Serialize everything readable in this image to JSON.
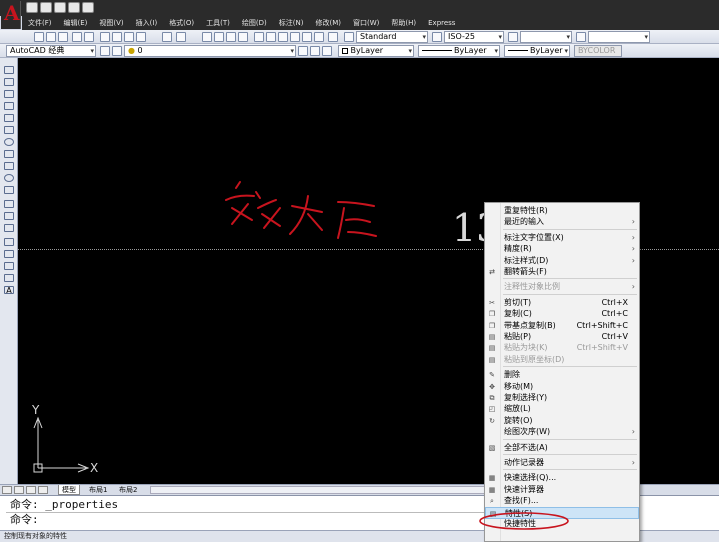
{
  "menu": [
    "文件(F)",
    "编辑(E)",
    "视图(V)",
    "插入(I)",
    "格式(O)",
    "工具(T)",
    "绘图(D)",
    "标注(N)",
    "修改(M)",
    "窗口(W)",
    "帮助(H)",
    "Express"
  ],
  "toolbar": {
    "text_style": "Standard",
    "dim_style": "ISO-25",
    "workspace": "AutoCAD 经典",
    "layer": "0",
    "color": "ByLayer",
    "linetype": "ByLayer",
    "lineweight": "ByLayer",
    "plotstyle": "BYCOLOR"
  },
  "canvas": {
    "dimension_text": "13",
    "ucs_x": "X",
    "ucs_y": "Y",
    "background": "#000000",
    "annotation_color": "#c8141e"
  },
  "tabs": [
    "模型",
    "布局1",
    "布局2"
  ],
  "command": {
    "line1": "命令: _properties",
    "line2": "命令:"
  },
  "status": "控制现有对象的特性",
  "context_menu": [
    {
      "label": "重复特性(R)",
      "icon": ""
    },
    {
      "label": "最近的输入",
      "arrow": true
    },
    {
      "sep": true
    },
    {
      "label": "标注文字位置(X)",
      "arrow": true
    },
    {
      "label": "精度(R)",
      "arrow": true
    },
    {
      "label": "标注样式(D)",
      "arrow": true
    },
    {
      "label": "翻转箭头(F)",
      "icon": "flip-arrow-icon"
    },
    {
      "sep": true
    },
    {
      "label": "注释性对象比例",
      "arrow": true,
      "disabled": true
    },
    {
      "sep": true
    },
    {
      "label": "剪切(T)",
      "shortcut": "Ctrl+X",
      "icon": "scissors-icon"
    },
    {
      "label": "复制(C)",
      "shortcut": "Ctrl+C",
      "icon": "copy-icon"
    },
    {
      "label": "带基点复制(B)",
      "shortcut": "Ctrl+Shift+C",
      "icon": "copy-base-icon"
    },
    {
      "label": "粘贴(P)",
      "shortcut": "Ctrl+V",
      "icon": "paste-icon"
    },
    {
      "label": "粘贴为块(K)",
      "shortcut": "Ctrl+Shift+V",
      "icon": "paste-block-icon",
      "disabled": true
    },
    {
      "label": "粘贴到原坐标(D)",
      "icon": "paste-orig-icon",
      "disabled": true
    },
    {
      "sep": true
    },
    {
      "label": "删除",
      "icon": "erase-icon"
    },
    {
      "label": "移动(M)",
      "icon": "move-icon"
    },
    {
      "label": "复制选择(Y)",
      "icon": "copy-select-icon"
    },
    {
      "label": "缩放(L)",
      "icon": "scale-icon"
    },
    {
      "label": "旋转(O)",
      "icon": "rotate-icon"
    },
    {
      "label": "绘图次序(W)",
      "arrow": true
    },
    {
      "sep": true
    },
    {
      "label": "全部不选(A)",
      "icon": "deselect-icon"
    },
    {
      "sep": true
    },
    {
      "label": "动作记录器",
      "arrow": true
    },
    {
      "sep": true
    },
    {
      "label": "快速选择(Q)...",
      "icon": "qselect-icon"
    },
    {
      "label": "快速计算器",
      "icon": "calculator-icon"
    },
    {
      "label": "查找(F)...",
      "icon": "find-icon"
    },
    {
      "label": "特性(S)",
      "icon": "properties-icon",
      "highlighted": true
    },
    {
      "label": "快捷特性",
      "icon": ""
    }
  ]
}
